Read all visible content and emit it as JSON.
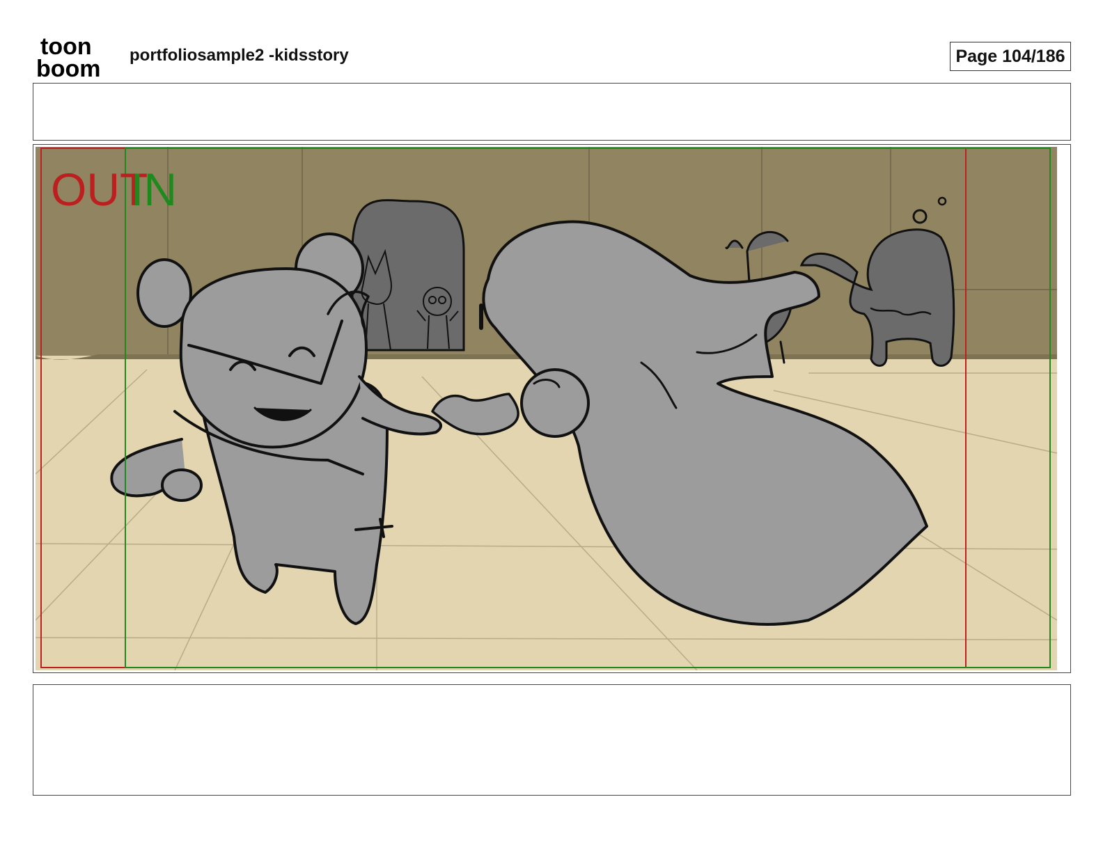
{
  "header": {
    "logo_top": "toon",
    "logo_bottom": "boom",
    "title": "portfoliosample2 -kidsstory",
    "page_label": "Page 104/186"
  },
  "panel": {
    "out_label": "OUT",
    "in_label": "IN",
    "colors": {
      "wall": "#918460",
      "floor": "#e2d5b0",
      "character_fill": "#9c9c9c",
      "shadow_fill": "#6a6a6a",
      "outline": "#111111",
      "out_frame": "#bb1f1f",
      "in_frame": "#1e8a1e"
    }
  },
  "notes": {
    "top_text": "",
    "bottom_text": ""
  }
}
